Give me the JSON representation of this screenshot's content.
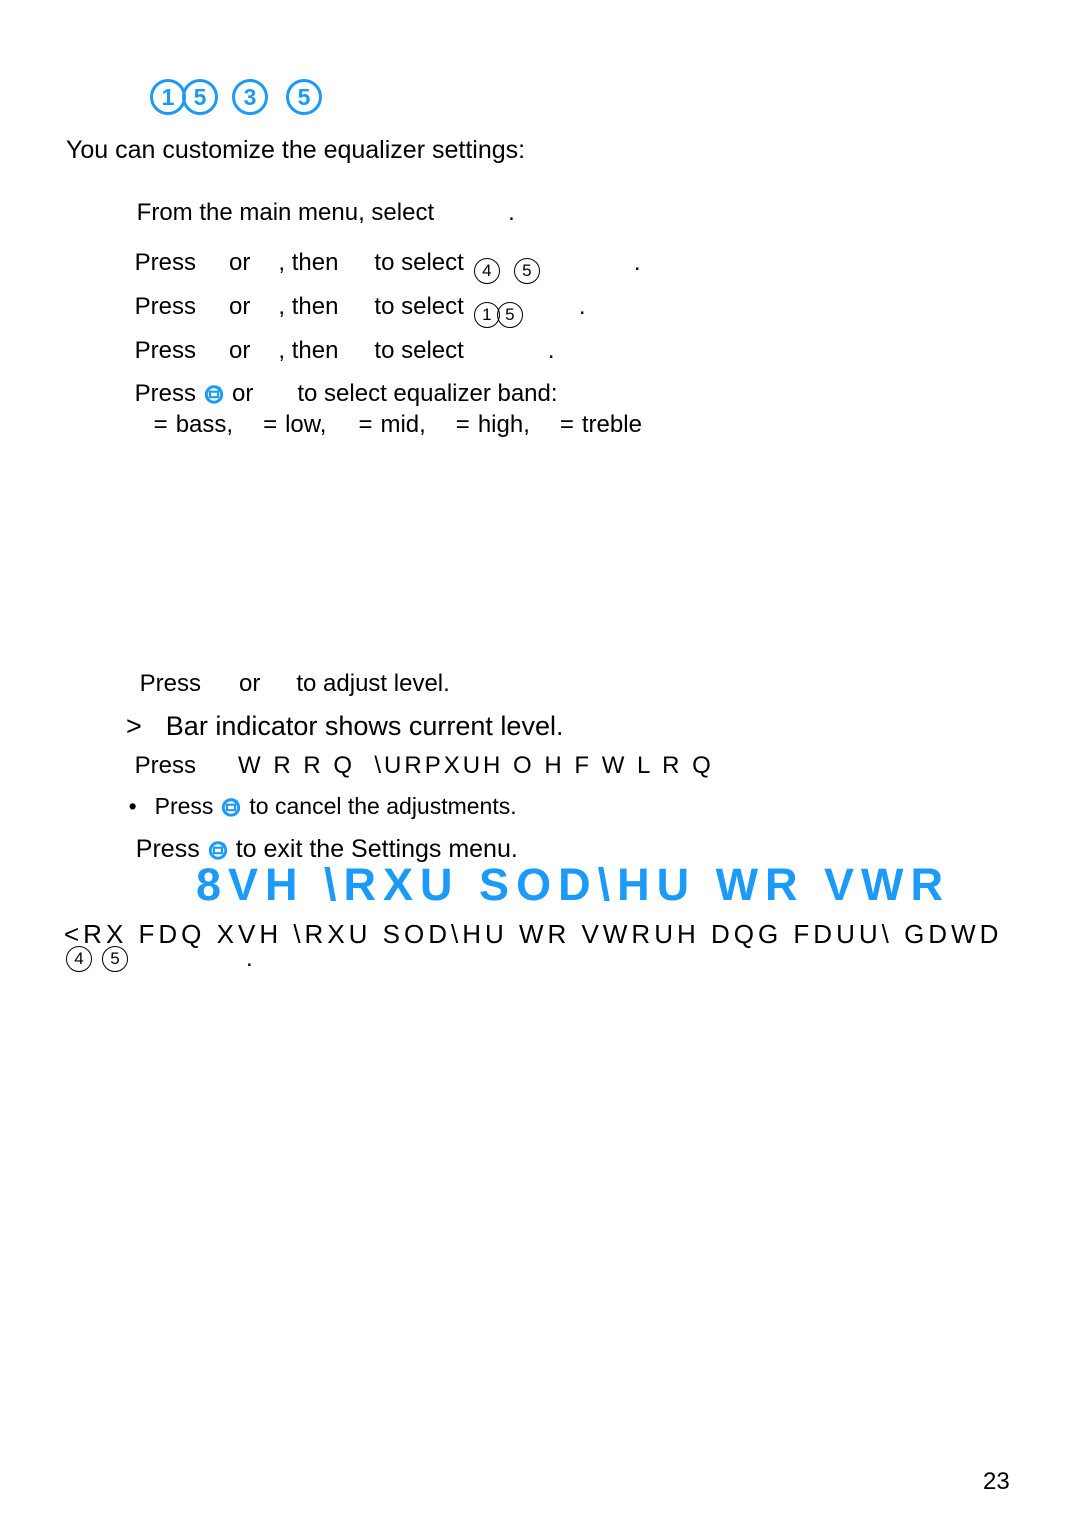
{
  "document": {
    "page_number": "23",
    "accent_color": "#1b9af7",
    "text_color": "#000000",
    "background_color": "#ffffff"
  },
  "step_badges_header": {
    "name": "step-number-badges",
    "values": [
      "1",
      "5",
      "3",
      "5"
    ]
  },
  "intro": {
    "line": "You can customize the equalizer settings:"
  },
  "steps": [
    {
      "text": "From the main menu, select",
      "trailing": "."
    },
    {
      "prefix": "Press",
      "mid": "or",
      "then": ", then",
      "select": "to select",
      "badges": [
        "4",
        "5"
      ],
      "trailing": "."
    },
    {
      "prefix": "Press",
      "mid": "or",
      "then": ", then",
      "select": "to select",
      "badges": [
        "1",
        "5"
      ],
      "trailing": "."
    },
    {
      "prefix": "Press",
      "mid": "or",
      "then": ", then",
      "select": "to select",
      "badges": [],
      "trailing": "."
    }
  ],
  "band_step": {
    "prefix": "Press",
    "icon": "return-key-icon",
    "mid": "or",
    "suffix": "to select equalizer band:",
    "bands": [
      {
        "eq": "=",
        "label": "bass,"
      },
      {
        "eq": "=",
        "label": "low,"
      },
      {
        "eq": "=",
        "label": "mid,"
      },
      {
        "eq": "=",
        "label": "high,"
      },
      {
        "eq": "=",
        "label": "treble"
      }
    ]
  },
  "adjust": {
    "prefix": "Press",
    "mid": "or",
    "suffix": "to adjust level."
  },
  "note": {
    "marker": ">",
    "text": "Bar indicator shows current level."
  },
  "confirm": {
    "prefix": "Press",
    "garbled": "W R R Q  \\URPXUH O H F W L R Q"
  },
  "cancel": {
    "bullet": "•",
    "prefix": "Press",
    "icon": "return-key-icon",
    "suffix": "to cancel the adjustments."
  },
  "exit": {
    "prefix": "Press",
    "icon": "return-key-icon",
    "suffix": "to exit the Settings menu."
  },
  "section": {
    "heading_garbled": "8VH \\RXU SOD\\HU WR VWR",
    "body_garbled": "<RX FDQ XVH \\RXU SOD\\HU WR VWRUH DQG FDUU\\ GDWD",
    "badges": [
      "4",
      "5"
    ],
    "trailing": "."
  }
}
